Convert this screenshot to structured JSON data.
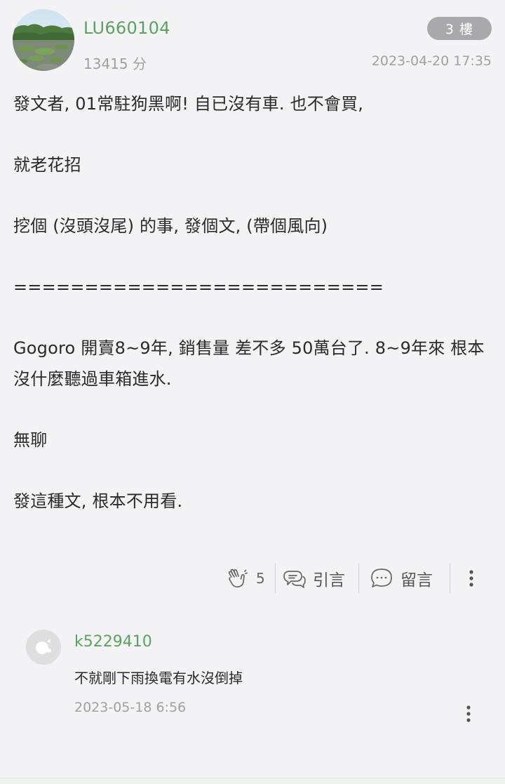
{
  "post": {
    "username": "LU660104",
    "score": "13415 分",
    "floor": "3 樓",
    "timestamp": "2023-04-20 17:35",
    "body": [
      "發文者, 01常駐狗黑啊! 自已沒有車. 也不會買,",
      "",
      "就老花招",
      "",
      "挖個 (沒頭沒尾) 的事, 發個文, (帶個風向)",
      "",
      "==========================",
      "",
      "Gogoro 開賣8~9年, 銷售量 差不多 50萬台了. 8~9年來 根本沒什麼聽過車箱進水.",
      "",
      "無聊",
      "",
      "發這種文, 根本不用看."
    ]
  },
  "actions": {
    "like_count": "5",
    "quote_label": "引言",
    "comment_label": "留言"
  },
  "reply": {
    "username": "k5229410",
    "text": "不就剛下雨換電有水沒倒掉",
    "timestamp": "2023-05-18 6:56"
  },
  "icons": {
    "like": "clap-hands-icon",
    "quote": "quote-bubbles-icon",
    "comment": "comment-bubble-icon",
    "more": "more-vertical-icon"
  },
  "colors": {
    "username": "#5aa35e",
    "badge_bg": "#a9a9ab",
    "meta_text": "#a0a0a0",
    "background": "#f3f3f5"
  }
}
